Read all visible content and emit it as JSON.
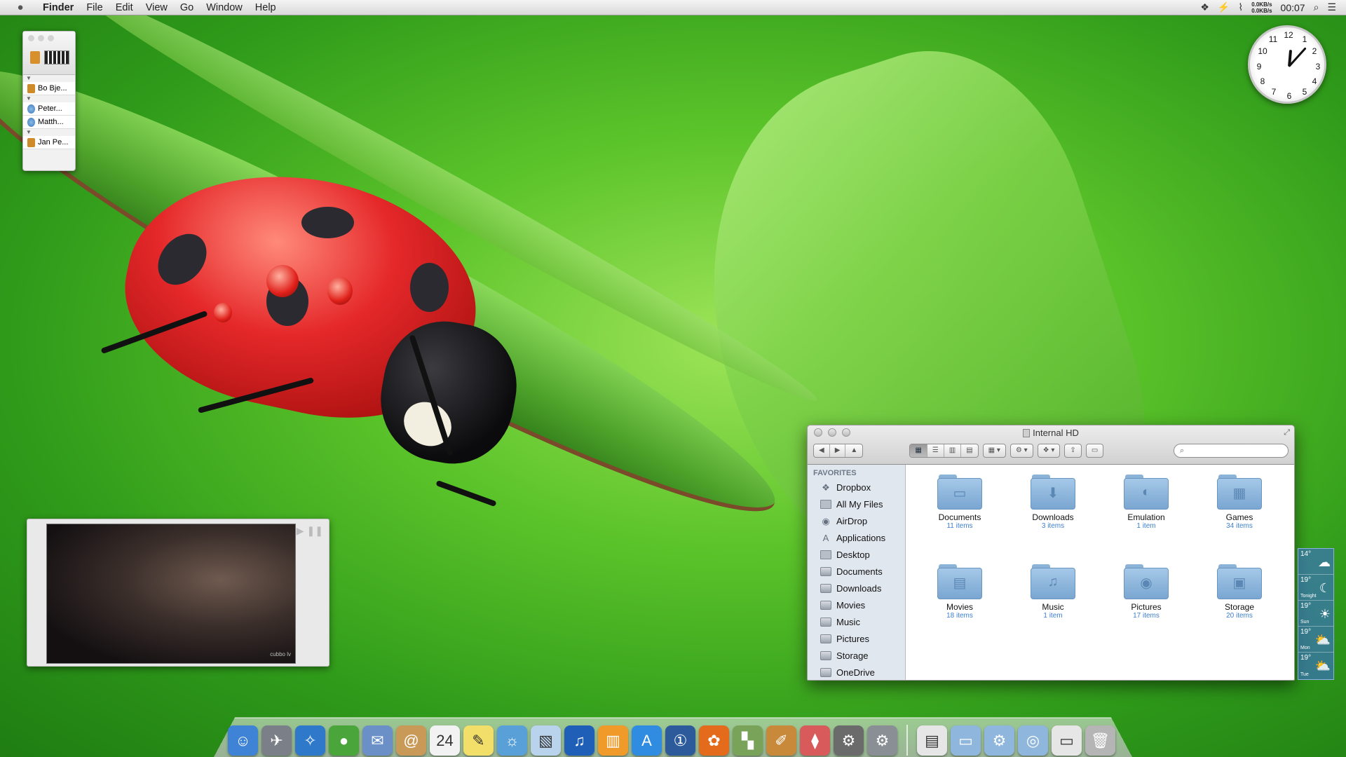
{
  "menubar": {
    "app_name": "Finder",
    "menus": [
      "File",
      "Edit",
      "View",
      "Go",
      "Window",
      "Help"
    ],
    "net_up": "0.0KB/s",
    "net_down": "0.0KB/s",
    "time": "00:07",
    "icons": [
      "dropbox-icon",
      "network-icon",
      "wifi-icon",
      "search-icon",
      "list-icon"
    ]
  },
  "contacts_widget": {
    "entries": [
      "Bo Bje...",
      "Peter...",
      "Matth...",
      "Jan Pe..."
    ]
  },
  "clock": {
    "numbers": [
      "12",
      "1",
      "2",
      "3",
      "4",
      "5",
      "6",
      "7",
      "8",
      "9",
      "10",
      "11"
    ]
  },
  "video": {
    "watermark": "cubbo lv"
  },
  "finder": {
    "title": "Internal HD",
    "favorites_header": "FAVORITES",
    "sidebar": [
      {
        "label": "Dropbox",
        "icon": "dropbox-icon"
      },
      {
        "label": "All My Files",
        "icon": "all-files-icon"
      },
      {
        "label": "AirDrop",
        "icon": "airdrop-icon"
      },
      {
        "label": "Applications",
        "icon": "applications-icon"
      },
      {
        "label": "Desktop",
        "icon": "desktop-icon"
      },
      {
        "label": "Documents",
        "icon": "folder-icon"
      },
      {
        "label": "Downloads",
        "icon": "folder-icon"
      },
      {
        "label": "Movies",
        "icon": "folder-icon"
      },
      {
        "label": "Music",
        "icon": "folder-icon"
      },
      {
        "label": "Pictures",
        "icon": "folder-icon"
      },
      {
        "label": "Storage",
        "icon": "folder-icon"
      },
      {
        "label": "OneDrive",
        "icon": "folder-icon"
      }
    ],
    "folders": [
      {
        "name": "Documents",
        "count": "11 items",
        "glyph": "▭"
      },
      {
        "name": "Downloads",
        "count": "3 items",
        "glyph": "⬇"
      },
      {
        "name": "Emulation",
        "count": "1 item",
        "glyph": "◐"
      },
      {
        "name": "Games",
        "count": "34 items",
        "glyph": "▦"
      },
      {
        "name": "Movies",
        "count": "18 items",
        "glyph": "▤"
      },
      {
        "name": "Music",
        "count": "1 item",
        "glyph": "♫"
      },
      {
        "name": "Pictures",
        "count": "17 items",
        "glyph": "◉"
      },
      {
        "name": "Storage",
        "count": "20 items",
        "glyph": "▣"
      }
    ]
  },
  "weather": [
    {
      "temp": "14°",
      "day": "",
      "icon": "cloudy-icon"
    },
    {
      "temp": "19°",
      "day": "Tonight",
      "icon": "moon-icon"
    },
    {
      "temp": "19°",
      "day": "Sun",
      "icon": "sun-icon"
    },
    {
      "temp": "19°",
      "day": "Mon",
      "icon": "partly-cloudy-icon"
    },
    {
      "temp": "19°",
      "day": "Tue",
      "icon": "partly-cloudy-icon"
    }
  ],
  "dock": [
    {
      "name": "finder-icon",
      "color": "#3f83d6",
      "glyph": "☺"
    },
    {
      "name": "launchpad-icon",
      "color": "#7a7f88",
      "glyph": "✈"
    },
    {
      "name": "safari-icon",
      "color": "#2e79c9",
      "glyph": "✧"
    },
    {
      "name": "adium-icon",
      "color": "#4aa53a",
      "glyph": "●"
    },
    {
      "name": "mail-icon",
      "color": "#6b90c8",
      "glyph": "✉"
    },
    {
      "name": "contacts-icon",
      "color": "#c99a57",
      "glyph": "@"
    },
    {
      "name": "calendar-icon",
      "color": "#f2f2f2",
      "glyph": "24"
    },
    {
      "name": "stickies-icon",
      "color": "#f2df6a",
      "glyph": "✎"
    },
    {
      "name": "iphoto-icon",
      "color": "#5aa0d8",
      "glyph": "☼"
    },
    {
      "name": "preview-icon",
      "color": "#b9d3ec",
      "glyph": "▧"
    },
    {
      "name": "itunes-icon",
      "color": "#1f5fb8",
      "glyph": "♫"
    },
    {
      "name": "ibooks-icon",
      "color": "#f09a2a",
      "glyph": "▥"
    },
    {
      "name": "app-store-icon",
      "color": "#2f8ce0",
      "glyph": "A"
    },
    {
      "name": "onepassword-icon",
      "color": "#2c5a9a",
      "glyph": "①"
    },
    {
      "name": "flower-app-icon",
      "color": "#e46a1c",
      "glyph": "✿"
    },
    {
      "name": "maps-icon",
      "color": "#7aa35a",
      "glyph": "▚"
    },
    {
      "name": "pixelmator-icon",
      "color": "#c9893a",
      "glyph": "✐"
    },
    {
      "name": "icecream-icon",
      "color": "#d85a5a",
      "glyph": "⧫"
    },
    {
      "name": "forklift-icon",
      "color": "#6b6b6b",
      "glyph": "⚙"
    },
    {
      "name": "system-preferences-icon",
      "color": "#8a8f96",
      "glyph": "⚙"
    },
    {
      "name": "sep",
      "color": "",
      "glyph": ""
    },
    {
      "name": "document-stack-icon",
      "color": "#e6e6e6",
      "glyph": "▤"
    },
    {
      "name": "folder-stack-icon",
      "color": "#8fb6dd",
      "glyph": "▭"
    },
    {
      "name": "settings-stack-icon",
      "color": "#8fb6dd",
      "glyph": "⚙"
    },
    {
      "name": "apps-stack-icon",
      "color": "#8fb6dd",
      "glyph": "◎"
    },
    {
      "name": "desktop-stack-icon",
      "color": "#e6e6e6",
      "glyph": "▭"
    },
    {
      "name": "trash-icon",
      "color": "#b5b5b5",
      "glyph": "🗑"
    }
  ]
}
